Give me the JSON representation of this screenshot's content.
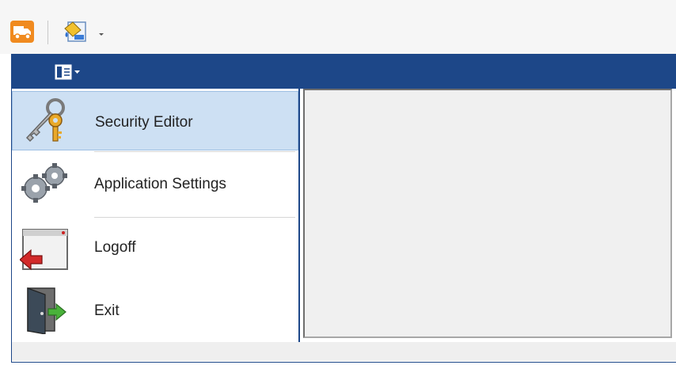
{
  "quick_access": {
    "items": [
      {
        "icon": "truck-icon"
      },
      {
        "icon": "paint-bucket-icon"
      },
      {
        "icon": "dropdown-arrow-icon"
      }
    ]
  },
  "ribbon": {
    "nav_toggle_icon": "navigation-pane-icon",
    "color": "#1d4788"
  },
  "nav": {
    "items": [
      {
        "label": "Security Editor",
        "icon": "keys-icon",
        "selected": true
      },
      {
        "label": "Application Settings",
        "icon": "gears-icon",
        "selected": false
      },
      {
        "label": "Logoff",
        "icon": "logoff-window-icon",
        "selected": false
      },
      {
        "label": "Exit",
        "icon": "exit-door-icon",
        "selected": false
      }
    ]
  },
  "colors": {
    "selected_bg": "#cde0f3",
    "accent": "#1d4788"
  }
}
